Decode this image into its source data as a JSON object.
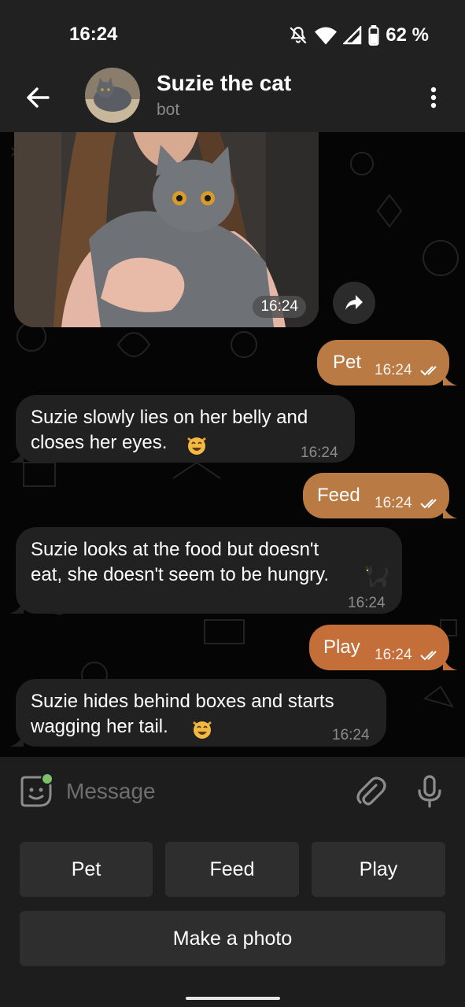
{
  "status_bar": {
    "time": "16:24",
    "battery": "62 %"
  },
  "header": {
    "title": "Suzie the cat",
    "subtitle": "bot"
  },
  "messages": [
    {
      "type": "photo",
      "time": "16:24"
    },
    {
      "type": "out",
      "text": "Pet",
      "time": "16:24"
    },
    {
      "type": "in",
      "text_line1": "Suzie slowly lies on her belly and",
      "text_line2": "closes her eyes.",
      "time": "16:24",
      "emoji": "smiling-cat"
    },
    {
      "type": "out",
      "text": "Feed",
      "time": "16:24"
    },
    {
      "type": "in",
      "text_line1": "Suzie looks at the food but doesn't",
      "text_line2": "eat, she doesn't seem to be hungry.",
      "time": "16:24",
      "emoji": "black-cat"
    },
    {
      "type": "out",
      "text": "Play",
      "time": "16:24"
    },
    {
      "type": "in",
      "text_line1": "Suzie hides behind boxes and starts",
      "text_line2": "wagging her tail.",
      "time": "16:24",
      "emoji": "smiling-cat"
    }
  ],
  "input": {
    "placeholder": "Message"
  },
  "keyboard": {
    "pet": "Pet",
    "feed": "Feed",
    "play": "Play",
    "photo": "Make a photo"
  },
  "colors": {
    "outgoing_bubble": "#b97a43",
    "incoming_bubble": "#212121",
    "online_dot": "#7cc26d"
  },
  "icons": [
    "back-arrow-icon",
    "more-vertical-icon",
    "forward-icon",
    "double-check-icon",
    "sticker-icon",
    "attach-icon",
    "mic-icon",
    "mute-icon",
    "wifi-icon",
    "signal-icon",
    "battery-icon"
  ]
}
